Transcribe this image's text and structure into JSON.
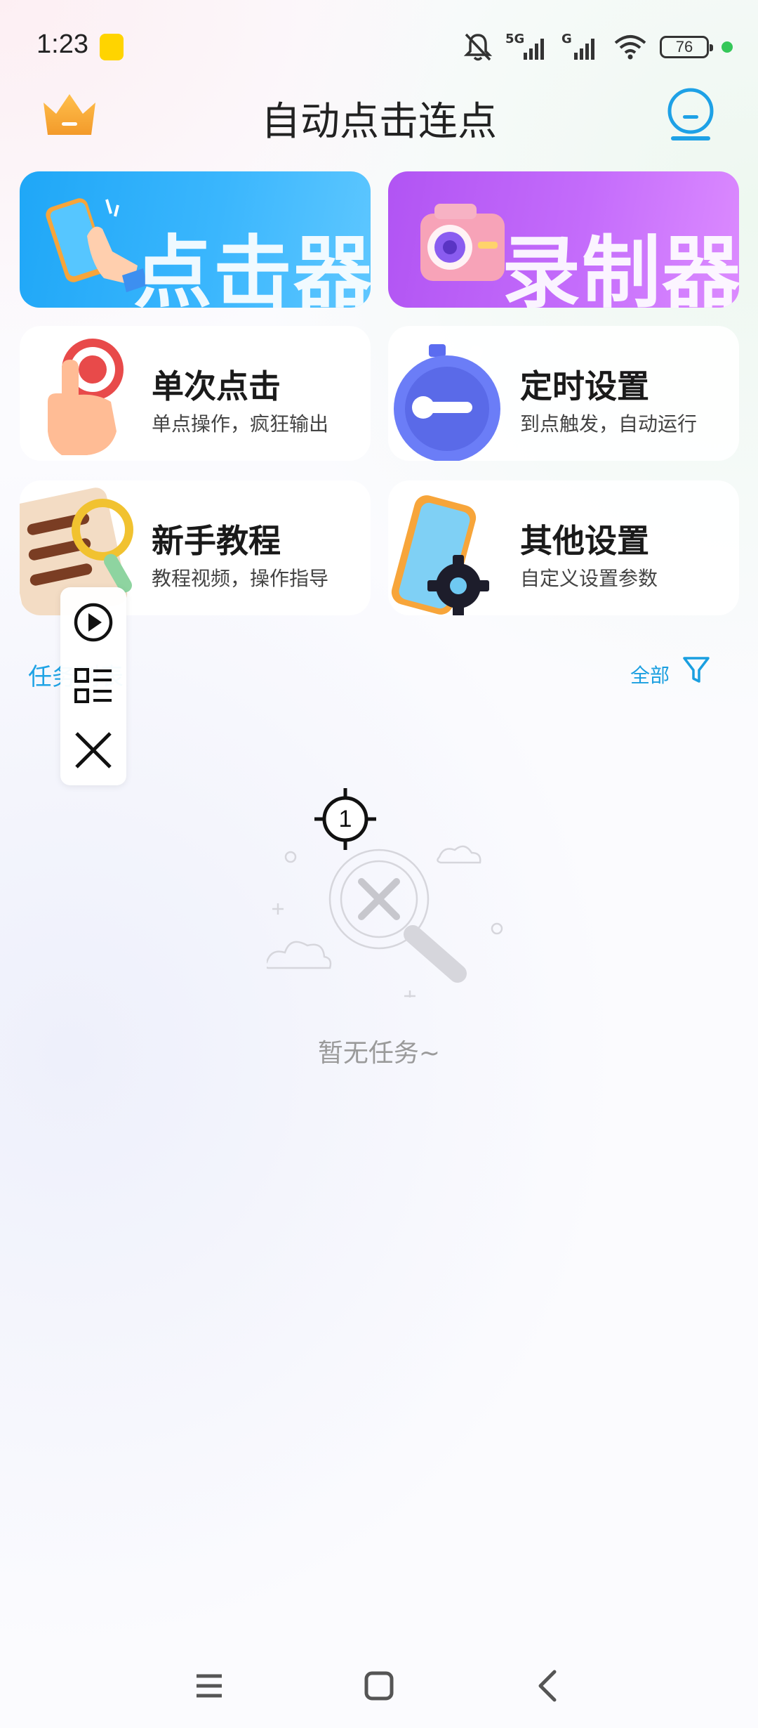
{
  "status_bar": {
    "time": "1:23",
    "network_5g": "5G",
    "network_g": "G",
    "battery": "76",
    "icons": [
      "app-badge-icon",
      "mute-bell-icon",
      "signal-5g-icon",
      "signal-g-icon",
      "wifi-icon",
      "battery-icon"
    ]
  },
  "header": {
    "title": "自动点击连点",
    "left_icon": "crown-icon",
    "right_icon": "robot-icon"
  },
  "banners": [
    {
      "label": "点击器",
      "color": "#2aa9f7",
      "icon": "hand-phone-icon"
    },
    {
      "label": "录制器",
      "color": "#c36cf9",
      "icon": "camera-icon"
    }
  ],
  "features": [
    {
      "title": "单次点击",
      "subtitle": "单点操作，疯狂输出",
      "icon": "tap-target-icon"
    },
    {
      "title": "定时设置",
      "subtitle": "到点触发，自动运行",
      "icon": "stopwatch-icon"
    },
    {
      "title": "新手教程",
      "subtitle": "教程视频，操作指导",
      "icon": "magnifier-list-icon"
    },
    {
      "title": "其他设置",
      "subtitle": "自定义设置参数",
      "icon": "gear-phone-icon"
    }
  ],
  "tasks": {
    "section_label": "任务列表",
    "filter_label": "全部",
    "empty_text": "暂无任务~"
  },
  "floating_toolbar": {
    "items": [
      "play-icon",
      "list-icon",
      "close-icon"
    ]
  },
  "target_marker": {
    "number": "1"
  },
  "nav_bar": {
    "items": [
      "menu-icon",
      "home-icon",
      "back-icon"
    ]
  },
  "colors": {
    "accent_blue": "#1fa3e5",
    "banner_blue": "#2aa9f7",
    "banner_purple": "#c36cf9"
  }
}
